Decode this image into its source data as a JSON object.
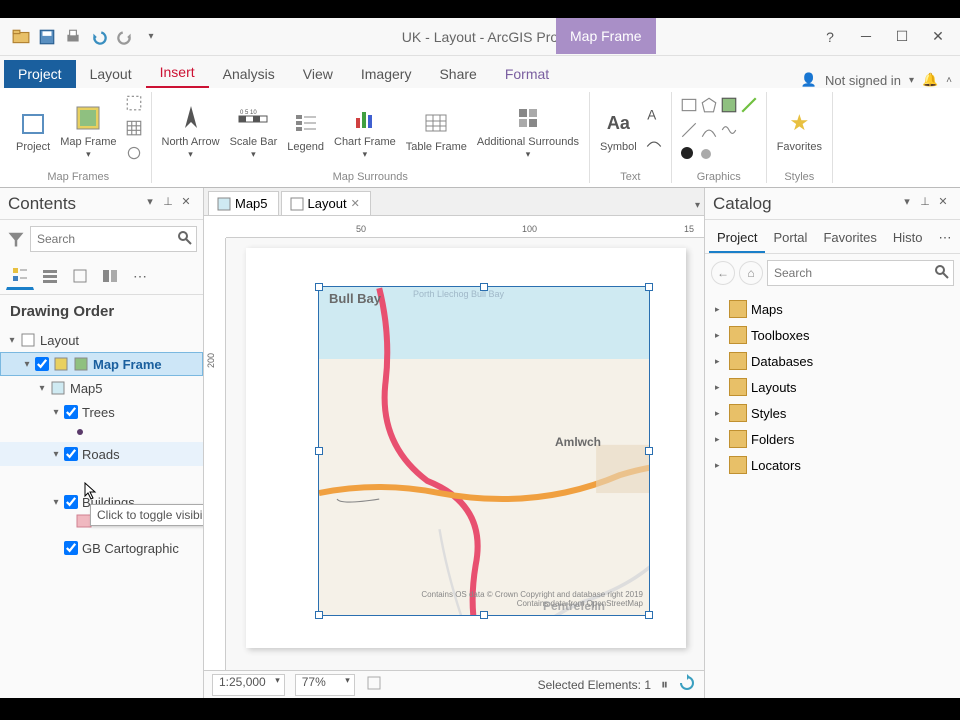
{
  "title": "UK - Layout - ArcGIS Pro",
  "context_tab": "Map Frame",
  "ribbon_tabs": [
    "Project",
    "Layout",
    "Insert",
    "Analysis",
    "View",
    "Imagery",
    "Share",
    "Format"
  ],
  "active_ribbon_tab": "Insert",
  "signin": "Not signed in",
  "ribbon_groups": {
    "map_frames": {
      "label": "Map Frames",
      "items": {
        "project": "Project",
        "map_frame": "Map Frame"
      }
    },
    "map_surrounds": {
      "label": "Map Surrounds",
      "items": {
        "north_arrow": "North Arrow",
        "scale_bar": "Scale Bar",
        "legend": "Legend",
        "chart_frame": "Chart Frame",
        "table_frame": "Table Frame",
        "additional": "Additional Surrounds"
      }
    },
    "text": {
      "label": "Text",
      "symbol": "Symbol"
    },
    "graphics": {
      "label": "Graphics"
    },
    "styles": {
      "label": "Styles",
      "favorites": "Favorites"
    }
  },
  "contents": {
    "title": "Contents",
    "search_placeholder": "Search",
    "section": "Drawing Order",
    "tree": {
      "layout": "Layout",
      "map_frame": "Map Frame",
      "map5": "Map5",
      "trees": "Trees",
      "roads": "Roads",
      "buildings": "Buildings",
      "gb": "GB Cartographic"
    },
    "tooltip": "Click to toggle visibility"
  },
  "doc_tabs": {
    "map": "Map5",
    "layout": "Layout"
  },
  "map_places": {
    "bull_bay": "Bull Bay",
    "porth": "Porth Llechog Bull Bay",
    "amlwch": "Amlwch",
    "pentref": "Pentrefelin"
  },
  "credits": {
    "l1": "Contains OS data © Crown Copyright and database right 2019",
    "l2": "Contains data from OpenStreetMap"
  },
  "ruler": {
    "n50": "50",
    "n100": "100",
    "n150": "15",
    "v200": "200"
  },
  "status": {
    "scale": "1:25,000",
    "zoom": "77%",
    "selected": "Selected Elements: 1"
  },
  "catalog": {
    "title": "Catalog",
    "tabs": [
      "Project",
      "Portal",
      "Favorites",
      "Histo"
    ],
    "search_placeholder": "Search",
    "items": [
      "Maps",
      "Toolboxes",
      "Databases",
      "Layouts",
      "Styles",
      "Folders",
      "Locators"
    ]
  }
}
